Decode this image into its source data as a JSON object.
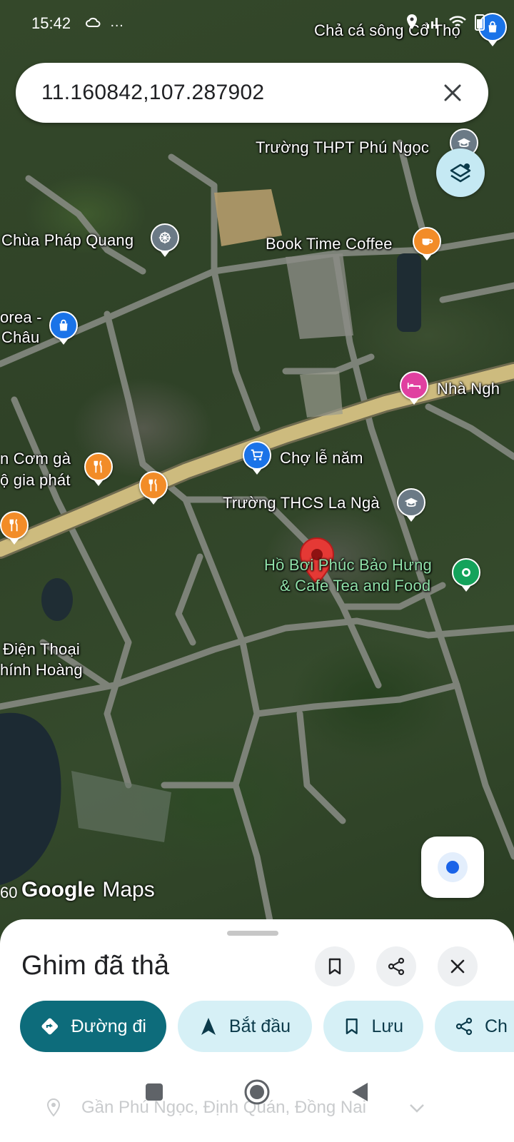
{
  "status_bar": {
    "time": "15:42",
    "extra_icons": "…"
  },
  "search": {
    "value": "11.160842,107.287902"
  },
  "map_labels": {
    "top_right": "Chả cá sông Cổ Thọ",
    "school_high": "Trường THPT Phú Ngọc",
    "pagoda": "Chùa Pháp Quang",
    "coffee": "Book Time Coffee",
    "korea_1": "orea -",
    "korea_2": "Châu",
    "hotel": "Nhà Ngh",
    "com_ga_1": "n Cơm gà",
    "com_ga_2": "ộ gia phát",
    "market": "Chợ lễ năm",
    "school_mid": "Trường THCS La Ngà",
    "pool_1": "Hồ Bơi Phúc Bảo Hưng",
    "pool_2": "& Cafe Tea and Food",
    "phone_1": "Điện Thoại",
    "phone_2": "hính Hoàng",
    "scale": "60"
  },
  "logo": {
    "google": "Google",
    "maps": "Maps"
  },
  "sheet": {
    "title": "Ghim đã thả",
    "address": "Gần Phú Ngọc, Định Quán, Đồng Nai",
    "chips": [
      {
        "label": "Đường đi",
        "icon": "directions-icon"
      },
      {
        "label": "Bắt đầu",
        "icon": "navigation-arrow-icon"
      },
      {
        "label": "Lưu",
        "icon": "bookmark-icon"
      },
      {
        "label": "Ch",
        "icon": "share-icon"
      }
    ]
  },
  "colors": {
    "primary_chip": "#0d6c7b",
    "chip_bg": "#d6f0f6",
    "pin_red": "#e53935",
    "poi_orange": "#f28c28",
    "poi_blue": "#1a73e8",
    "poi_pink": "#e040a0",
    "poi_gray": "#6b7a86",
    "poi_green": "#14a35b"
  }
}
